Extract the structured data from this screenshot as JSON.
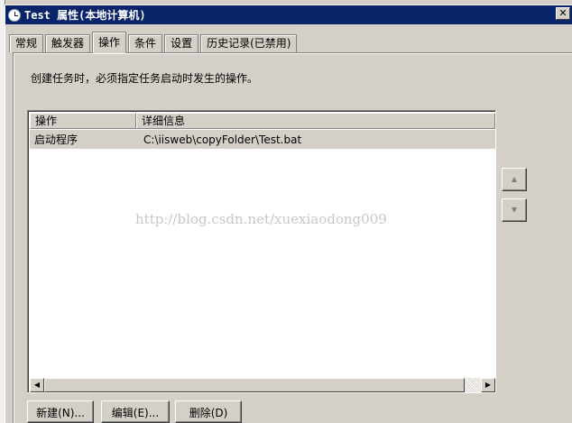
{
  "window": {
    "title": "Test 属性(本地计算机)",
    "close_glyph": "✕"
  },
  "tabs": [
    {
      "label": "常规"
    },
    {
      "label": "触发器"
    },
    {
      "label": "操作"
    },
    {
      "label": "条件"
    },
    {
      "label": "设置"
    },
    {
      "label": "历史记录(已禁用)"
    }
  ],
  "active_tab": "操作",
  "instruction": "创建任务时，必须指定任务启动时发生的操作。",
  "actions_table": {
    "columns": [
      "操作",
      "详细信息"
    ],
    "rows": [
      {
        "action": "启动程序",
        "details": "C:\\iisweb\\copyFolder\\Test.bat"
      }
    ]
  },
  "watermark": "http://blog.csdn.net/xuexiaodong009",
  "side_buttons": {
    "up_glyph": "▲",
    "down_glyph": "▼"
  },
  "scroll": {
    "left_glyph": "◀",
    "right_glyph": "▶"
  },
  "buttons": {
    "new": "新建(N)...",
    "edit": "编辑(E)...",
    "delete": "删除(D)"
  },
  "colors": {
    "titlebar": "#0a246a",
    "face": "#d4d0c8"
  },
  "icons": [
    "clock-icon",
    "close-icon",
    "move-up-icon",
    "move-down-icon",
    "scroll-left-icon",
    "scroll-right-icon"
  ]
}
